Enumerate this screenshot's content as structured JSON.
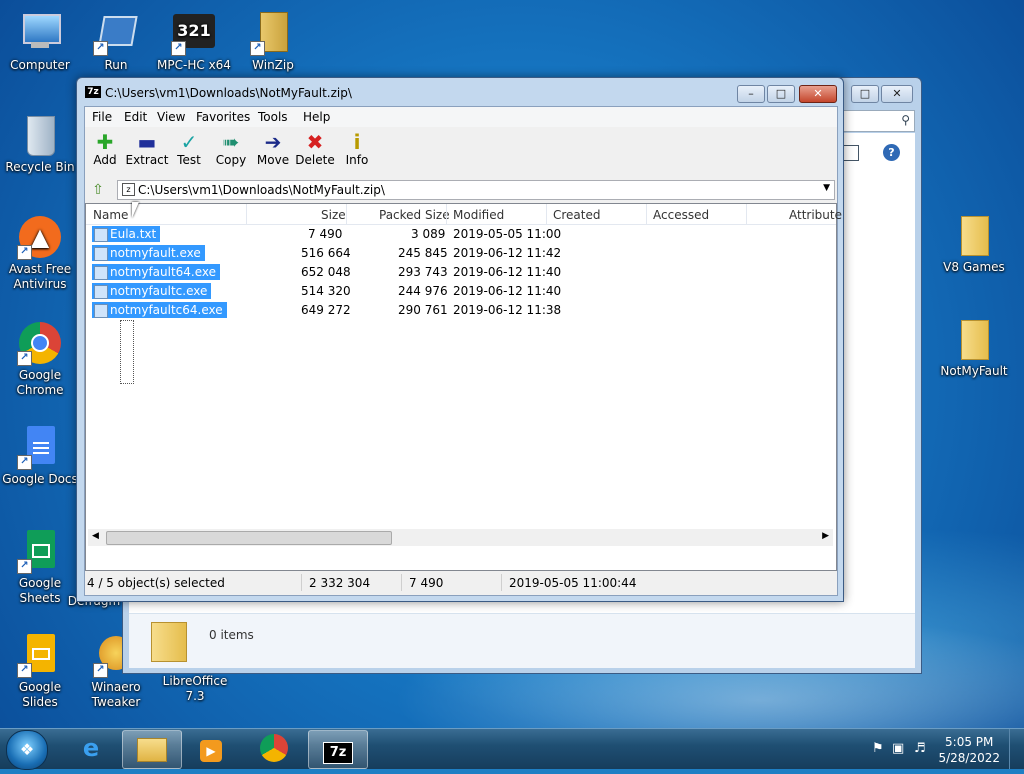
{
  "desktop_icons": {
    "computer": "Computer",
    "run": "Run",
    "mpc": "MPC-HC x64",
    "winzip": "WinZip",
    "recycle": "Recycle Bin",
    "avast": "Avast Free Antivirus",
    "chrome": "Google Chrome",
    "docs": "Google Docs",
    "sheets": "Google Sheets",
    "slides": "Google Slides",
    "defrag": "Defragm",
    "winaero": "Winaero Tweaker",
    "libre": "LibreOffice 7.3",
    "v8games": "V8 Games",
    "notmyfault": "NotMyFault"
  },
  "explorer": {
    "items_count": "0 items"
  },
  "zip_window": {
    "title": "C:\\Users\\vm1\\Downloads\\NotMyFault.zip\\",
    "menu": [
      "File",
      "Edit",
      "View",
      "Favorites",
      "Tools",
      "Help"
    ],
    "toolbar": [
      "Add",
      "Extract",
      "Test",
      "Copy",
      "Move",
      "Delete",
      "Info"
    ],
    "address": "C:\\Users\\vm1\\Downloads\\NotMyFault.zip\\",
    "columns": [
      "Name",
      "Size",
      "Packed Size",
      "Modified",
      "Created",
      "Accessed",
      "Attribute"
    ],
    "files": [
      {
        "name": "Eula.txt",
        "size": "7 490",
        "packed": "3 089",
        "modified": "2019-05-05 11:00"
      },
      {
        "name": "notmyfault.exe",
        "size": "516 664",
        "packed": "245 845",
        "modified": "2019-06-12 11:42"
      },
      {
        "name": "notmyfault64.exe",
        "size": "652 048",
        "packed": "293 743",
        "modified": "2019-06-12 11:40"
      },
      {
        "name": "notmyfaultc.exe",
        "size": "514 320",
        "packed": "244 976",
        "modified": "2019-06-12 11:40"
      },
      {
        "name": "notmyfaultc64.exe",
        "size": "649 272",
        "packed": "290 761",
        "modified": "2019-06-12 11:38"
      }
    ],
    "status": {
      "selection": "4 / 5 object(s) selected",
      "total_size": "2 332 304",
      "item_size": "7 490",
      "item_modified": "2019-05-05 11:00:44"
    }
  },
  "taskbar": {
    "time": "5:05 PM",
    "date": "5/28/2022"
  }
}
